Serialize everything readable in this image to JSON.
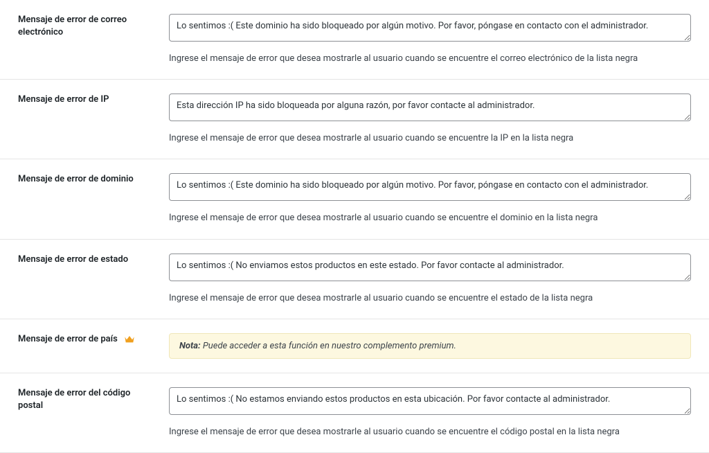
{
  "rows": {
    "email": {
      "label": "Mensaje de error de correo electrónico",
      "value": "Lo sentimos :( Este dominio ha sido bloqueado por algún motivo. Por favor, póngase en contacto con el administrador.",
      "help": "Ingrese el mensaje de error que desea mostrarle al usuario cuando se encuentre el correo electrónico de la lista negra"
    },
    "ip": {
      "label": "Mensaje de error de IP",
      "value": "Esta dirección IP ha sido bloqueada por alguna razón, por favor contacte al administrador.",
      "help": "Ingrese el mensaje de error que desea mostrarle al usuario cuando se encuentre la IP en la lista negra"
    },
    "domain": {
      "label": "Mensaje de error de dominio",
      "value": "Lo sentimos :( Este dominio ha sido bloqueado por algún motivo. Por favor, póngase en contacto con el administrador.",
      "help": "Ingrese el mensaje de error que desea mostrarle al usuario cuando se encuentre el dominio en la lista negra"
    },
    "state": {
      "label": "Mensaje de error de estado",
      "value": "Lo sentimos :( No enviamos estos productos en este estado. Por favor contacte al administrador.",
      "help": "Ingrese el mensaje de error que desea mostrarle al usuario cuando se encuentre el estado de la lista negra"
    },
    "country": {
      "label": "Mensaje de error de país",
      "notice_prefix": "Nota:",
      "notice_text": " Puede acceder a esta función en nuestro complemento premium."
    },
    "postal": {
      "label": "Mensaje de error del código postal",
      "value": "Lo sentimos :( No estamos enviando estos productos en esta ubicación. Por favor contacte al administrador.",
      "help": "Ingrese el mensaje de error que desea mostrarle al usuario cuando se encuentre el código postal en la lista negra"
    }
  }
}
